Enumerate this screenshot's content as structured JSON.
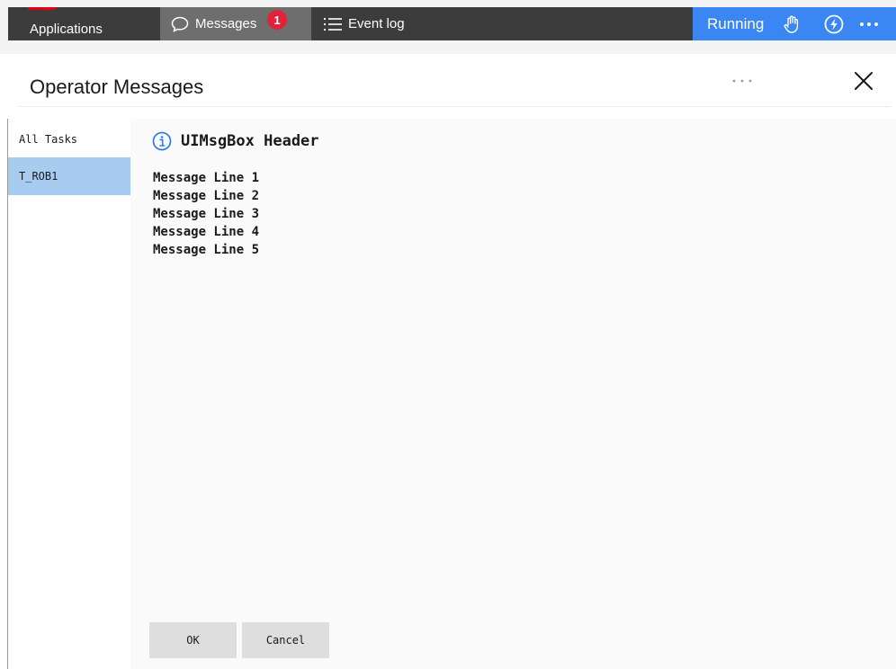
{
  "topbar": {
    "tabs": [
      {
        "label": "Applications",
        "icon": "none"
      },
      {
        "label": "Messages",
        "icon": "chat-bubble-icon",
        "badge": "1"
      },
      {
        "label": "Event log",
        "icon": "list-icon"
      }
    ],
    "status": {
      "label": "Running",
      "icons": [
        "hand-icon",
        "lightning-icon",
        "more-icon"
      ]
    },
    "colors": {
      "tab_dark": "#3c3c3c",
      "tab_active": "#6e6e6e",
      "status_blue": "#3a86f3",
      "badge_red": "#e3223a",
      "accent_red": "#e3000f"
    }
  },
  "page": {
    "title": "Operator Messages"
  },
  "sidebar": {
    "items": [
      {
        "label": "All Tasks",
        "selected": false
      },
      {
        "label": "T_ROB1",
        "selected": true
      }
    ],
    "selected_color": "#a7ccf0"
  },
  "message": {
    "header": "UIMsgBox Header",
    "icon": "info-icon",
    "lines": [
      "Message Line 1",
      "Message Line 2",
      "Message Line 3",
      "Message Line 4",
      "Message Line 5"
    ]
  },
  "buttons": {
    "ok": "OK",
    "cancel": "Cancel"
  }
}
